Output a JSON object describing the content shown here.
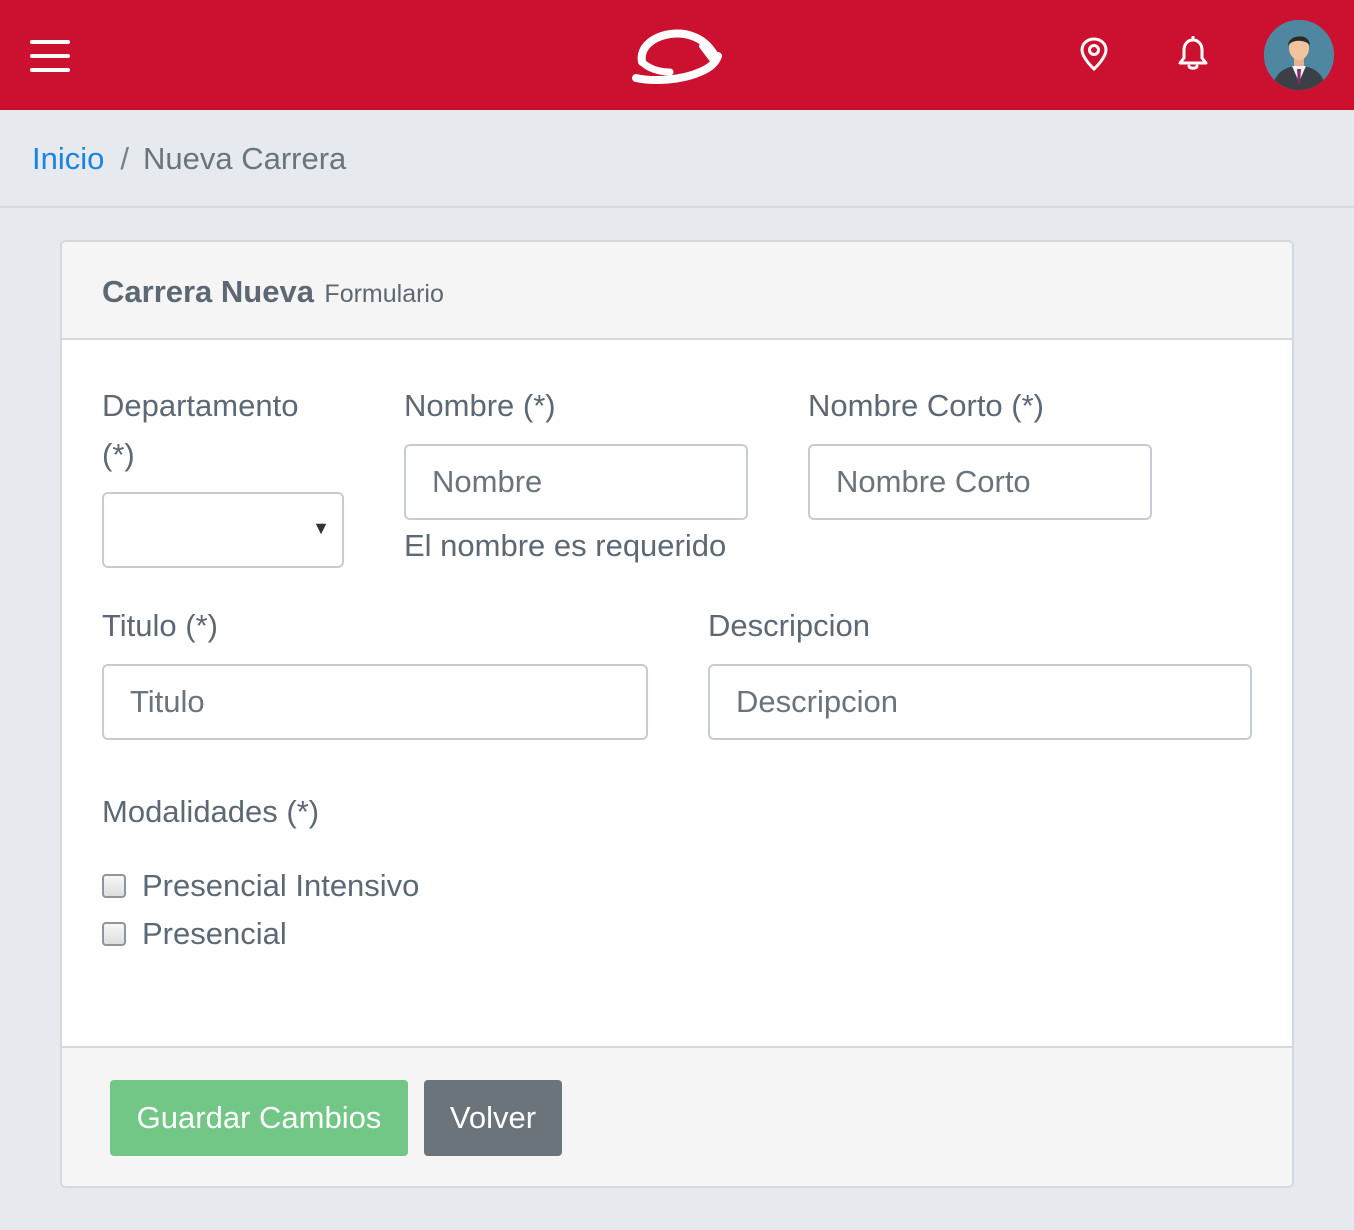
{
  "header": {
    "menu_icon": "hamburger-icon",
    "logo_icon": "brand-logo",
    "location_icon": "map-pin-icon",
    "notifications_icon": "bell-icon",
    "avatar_icon": "user-avatar",
    "brand_color": "#cc1130"
  },
  "breadcrumb": {
    "home_label": "Inicio",
    "separator": "/",
    "current_label": "Nueva Carrera"
  },
  "card": {
    "title": "Carrera Nueva",
    "subtitle": "Formulario"
  },
  "form": {
    "departamento": {
      "label_line1": "Departamento",
      "label_line2": "(*)",
      "value": "",
      "caret": "▼"
    },
    "nombre": {
      "label": "Nombre (*)",
      "placeholder": "Nombre",
      "help": "El nombre es requerido"
    },
    "nombre_corto": {
      "label": "Nombre Corto (*)",
      "placeholder": "Nombre Corto"
    },
    "titulo": {
      "label": "Titulo (*)",
      "placeholder": "Titulo"
    },
    "descripcion": {
      "label": "Descripcion",
      "placeholder": "Descripcion"
    },
    "modalidades": {
      "label": "Modalidades (*)",
      "options": [
        {
          "label": "Presencial Intensivo",
          "checked": false
        },
        {
          "label": "Presencial",
          "checked": false
        }
      ]
    }
  },
  "footer": {
    "save_label": "Guardar Cambios",
    "back_label": "Volver",
    "save_color": "#72c686",
    "back_color": "#6b737b"
  }
}
